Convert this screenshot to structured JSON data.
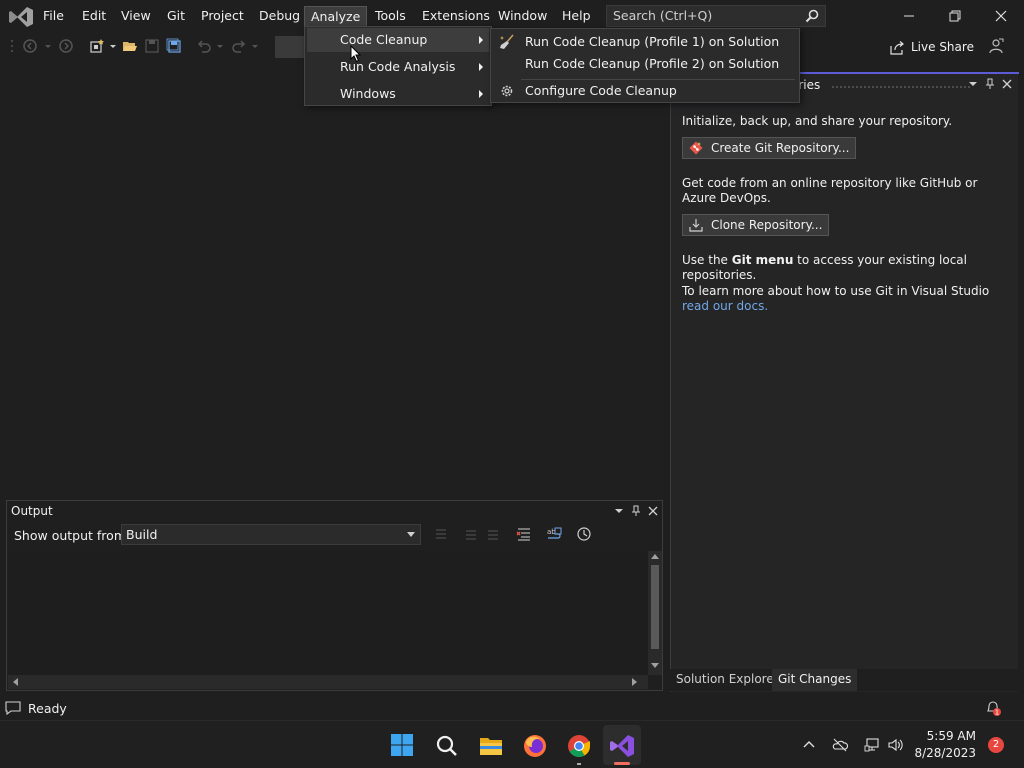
{
  "menubar": {
    "items": [
      "File",
      "Edit",
      "View",
      "Git",
      "Project",
      "Debug",
      "Analyze",
      "Tools",
      "Extensions",
      "Window",
      "Help"
    ],
    "search_placeholder": "Search (Ctrl+Q)"
  },
  "toolbar": {
    "live_share_label": "Live Share"
  },
  "analyze_menu": {
    "items": [
      {
        "label": "Code Cleanup",
        "has_submenu": true
      },
      {
        "label": "Run Code Analysis",
        "has_submenu": true
      },
      {
        "label": "Windows",
        "has_submenu": true
      }
    ]
  },
  "cleanup_submenu": {
    "items": [
      {
        "label": "Run Code Cleanup (Profile 1) on Solution",
        "icon": "broom-icon"
      },
      {
        "label": "Run Code Cleanup (Profile 2) on Solution",
        "icon": ""
      },
      {
        "label": "Configure Code Cleanup",
        "icon": "gear-icon"
      }
    ]
  },
  "right_panel": {
    "title_fragment": "ories",
    "intro_text": "Initialize, back up, and share your repository.",
    "create_button": "Create Git Repository...",
    "clone_intro": "Get code from an online repository like GitHub or Azure DevOps.",
    "clone_button": "Clone Repository...",
    "git_menu_prefix": "Use the ",
    "git_menu_bold": "Git menu",
    "git_menu_suffix": " to access your existing local repositories.",
    "learn_more": "To learn more about how to use Git in Visual Studio",
    "docs_link": "read our docs.",
    "tabs": [
      "Solution Explorer",
      "Git Changes"
    ],
    "active_tab": "Git Changes"
  },
  "output_panel": {
    "title": "Output",
    "show_output_label": "Show output from:",
    "source_value": "Build"
  },
  "statusbar": {
    "text": "Ready"
  },
  "taskbar": {
    "time": "5:59 AM",
    "date": "8/28/2023",
    "notification_count": "2",
    "bell_badge": "1"
  },
  "colors": {
    "accent": "#5c5cd6",
    "link": "#71a8e6",
    "vs_purple": "#a16ee8",
    "badge_red": "#e8473f"
  }
}
